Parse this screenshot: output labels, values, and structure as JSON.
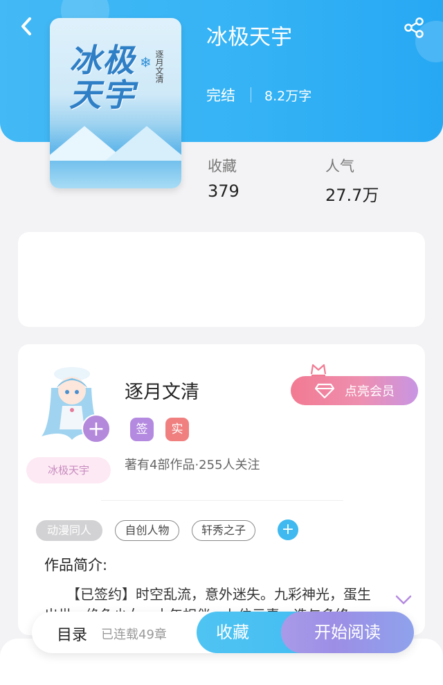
{
  "book": {
    "title": "冰极天宇",
    "status": "完结",
    "word_count": "8.2万字",
    "cover_title": "冰极天宇",
    "cover_author": "逐月文清"
  },
  "stats": [
    {
      "label": "收藏",
      "value": "379"
    },
    {
      "label": "人气",
      "value": "27.7万"
    }
  ],
  "author": {
    "name": "逐月文清",
    "badges": [
      {
        "text": "签",
        "color": "#b48ae0"
      },
      {
        "text": "实",
        "color": "#f08080"
      }
    ],
    "info": "著有4部作品·255人关注",
    "book_tag": "冰极天宇",
    "vip_label": "点亮会员"
  },
  "genre_tags": [
    "动漫同人",
    "自创人物",
    "轩秀之子"
  ],
  "intro": {
    "title": "作品简介:",
    "text": "【已签约】时空乱流，意外迷失。九彩神光，蛋生出世，绝色少女，十年相伴，九位元素，造与多终"
  },
  "bottom_bar": {
    "toc_label": "目录",
    "chapters": "已连载49章",
    "favorite_label": "收藏",
    "read_label": "开始阅读"
  },
  "colors": {
    "header": "#35b3f5",
    "accent_blue": "#45bdf1",
    "accent_purple": "#9c8ee5",
    "vip_pink": "#f27a92"
  },
  "icons": {
    "back": "back-arrow-icon",
    "share": "share-icon",
    "add_follow": "plus-icon",
    "crown": "crown-icon",
    "diamond": "diamond-icon",
    "add_tag": "plus-icon",
    "expand": "chevron-down-icon"
  }
}
